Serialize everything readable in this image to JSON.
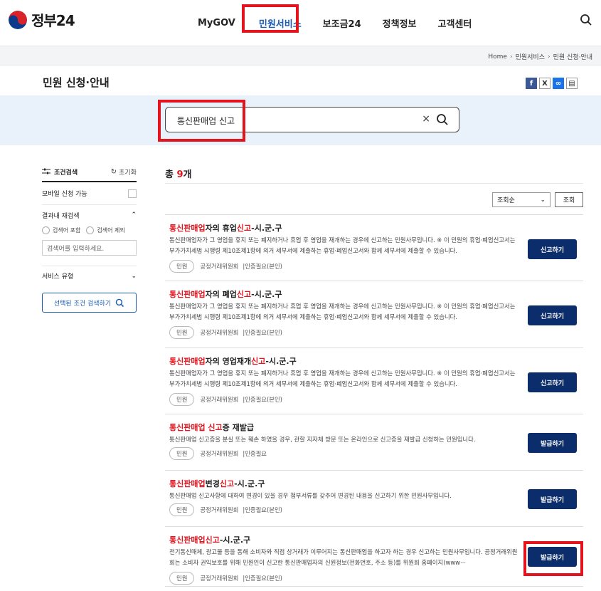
{
  "header": {
    "logo_text": "정부24",
    "nav": [
      {
        "label": "MyGOV",
        "active": false
      },
      {
        "label": "민원서비스",
        "active": true
      },
      {
        "label": "보조금24",
        "active": false
      },
      {
        "label": "정책정보",
        "active": false
      },
      {
        "label": "고객센터",
        "active": false
      }
    ],
    "search_icon": "search-icon"
  },
  "breadcrumb": [
    "Home",
    "민원서비스",
    "민원 신청·안내"
  ],
  "page": {
    "title": "민원 신청·안내",
    "share": [
      "facebook-icon",
      "x-icon",
      "link-icon",
      "print-icon"
    ]
  },
  "search": {
    "value": "통신판매업 신고",
    "clear_label": "×"
  },
  "filters": {
    "title": "조건검색",
    "reset_label": "초기화",
    "mobile_label": "모바일 신청 가능",
    "research_title": "결과내 재검색",
    "radio_include": "검색어 포함",
    "radio_exclude": "검색어 제외",
    "keyword_placeholder": "검색어를 입력하세요.",
    "service_type": "서비스 유형",
    "apply_label": "선택된 조건 검색하기"
  },
  "results": {
    "total_prefix": "총 ",
    "total_count": "9",
    "total_suffix": "개",
    "sort_value": "조회순",
    "sort_button": "조회",
    "items": [
      {
        "title_parts": [
          {
            "t": "통신판매업",
            "hl": true
          },
          {
            "t": "자의 휴업",
            "hl": false
          },
          {
            "t": "신고",
            "hl": true
          },
          {
            "t": "-시.군.구",
            "hl": false
          }
        ],
        "desc": "통신판매업자가 그 영업을 휴지 또는 폐지하거나 휴업 후 영업을 재개하는 경우에 신고하는 민원사무입니다. ※ 이 민원의 휴업·폐업신고서는 부가가치세법 시행령 제10조제1항에 의거 세무서에 제출하는 휴업·폐업신고서와 함께 세무서에 제출할 수 있습니다.",
        "tag": "민원",
        "org": "공정거래위원회",
        "auth": "인증필요(본인)",
        "button": "신고하기"
      },
      {
        "title_parts": [
          {
            "t": "통신판매업",
            "hl": true
          },
          {
            "t": "자의 폐업",
            "hl": false
          },
          {
            "t": "신고",
            "hl": true
          },
          {
            "t": "-시.군.구",
            "hl": false
          }
        ],
        "desc": "통신판매업자가 그 영업을 휴지 또는 폐지하거나 휴업 후 영업을 재개하는 경우에 신고하는 민원사무입니다. ※ 이 민원의 휴업·폐업신고서는 부가가치세법 시행령 제10조제1항에 의거 세무서에 제출하는 휴업·폐업신고서와 함께 세무서에 제출할 수 있습니다.",
        "tag": "민원",
        "org": "공정거래위원회",
        "auth": "인증필요(본인)",
        "button": "신고하기"
      },
      {
        "title_parts": [
          {
            "t": "통신판매업",
            "hl": true
          },
          {
            "t": "자의 영업재개",
            "hl": false
          },
          {
            "t": "신고",
            "hl": true
          },
          {
            "t": "-시.군.구",
            "hl": false
          }
        ],
        "desc": "통신판매업자가 그 영업을 휴지 또는 폐지하거나 휴업 후 영업을 재개하는 경우에 신고하는 민원사무입니다. ※ 이 민원의 휴업·폐업신고서는 부가가치세법 시행령 제10조제1항에 의거 세무서에 제출하는 휴업·폐업신고서와 함께 세무서에 제출할 수 있습니다.",
        "tag": "민원",
        "org": "공정거래위원회",
        "auth": "인증필요(본인)",
        "button": "신고하기"
      },
      {
        "title_parts": [
          {
            "t": "통신판매업 신고",
            "hl": true
          },
          {
            "t": "증 재발급",
            "hl": false
          }
        ],
        "desc": "통신판매업 신고증을 분실 또는 훼손 하였을 경우, 관할 지자체 방문 또는 온라인으로 신고증을 재발급 신청하는 민원입니다.",
        "tag": "민원",
        "org": "공정거래위원회",
        "auth": "인증필요",
        "button": "발급하기"
      },
      {
        "title_parts": [
          {
            "t": "통신판매업",
            "hl": true
          },
          {
            "t": "변경",
            "hl": false
          },
          {
            "t": "신고",
            "hl": true
          },
          {
            "t": "-시.군.구",
            "hl": false
          }
        ],
        "desc": "통신판매업 신고사항에 대하여 변경이 있을 경우 첨부서류를 갖추어 변경된 내용을 신고하기 위한 민원사무입니다.",
        "tag": "민원",
        "org": "공정거래위원회",
        "auth": "인증필요(본인)",
        "button": "발급하기"
      },
      {
        "title_parts": [
          {
            "t": "통신판매업신고",
            "hl": true
          },
          {
            "t": "-시.군.구",
            "hl": false
          }
        ],
        "desc": "전기통신매체, 광고물 등을 통해 소비자와 직접 상거래가 이루어지는 통신판매업을 하고자 하는 경우 신고하는 민원사무입니다. 공정거래위원회는 소비자 권익보호를 위해 민원인이 신고한 통신판매업자의 신원정보(전화번호, 주소 등)를 위원회 홈페이지(www···",
        "tag": "민원",
        "org": "공정거래위원회",
        "auth": "인증필요(본인)",
        "button": "발급하기"
      }
    ]
  }
}
